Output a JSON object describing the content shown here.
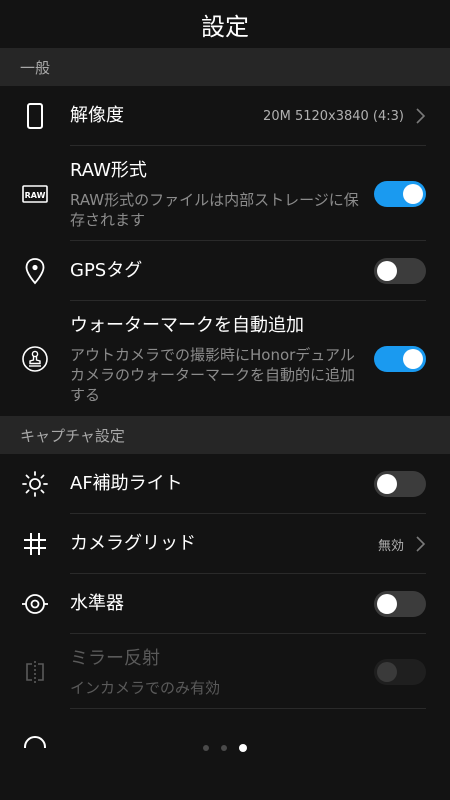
{
  "header": {
    "title": "設定"
  },
  "sections": {
    "general": {
      "label": "一般",
      "resolution": {
        "label": "解像度",
        "value": "20M 5120x3840 (4:3)"
      },
      "raw": {
        "label": "RAW形式",
        "description": "RAW形式のファイルは内部ストレージに保存されます",
        "icon_text": "RAW",
        "enabled": true
      },
      "gps": {
        "label": "GPSタグ",
        "enabled": false
      },
      "watermark": {
        "label": "ウォーターマークを自動追加",
        "description": "アウトカメラでの撮影時にHonorデュアルカメラのウォーターマークを自動的に追加する",
        "enabled": true
      }
    },
    "capture": {
      "label": "キャプチャ設定",
      "af_light": {
        "label": "AF補助ライト",
        "enabled": false
      },
      "grid": {
        "label": "カメラグリッド",
        "value": "無効"
      },
      "level": {
        "label": "水準器",
        "enabled": false
      },
      "mirror": {
        "label": "ミラー反射",
        "description": "インカメラでのみ有効",
        "enabled": false,
        "disabled": true
      }
    }
  },
  "pager": {
    "total": 3,
    "active": 3
  },
  "colors": {
    "accent": "#1a9af0",
    "background": "#131313",
    "section_bg": "#262626"
  },
  "icons": [
    "phone-outline-icon",
    "raw-badge-icon",
    "location-pin-icon",
    "watermark-stamp-icon",
    "sun-icon",
    "grid-hash-icon",
    "level-icon",
    "mirror-icon",
    "chevron-right-icon"
  ]
}
